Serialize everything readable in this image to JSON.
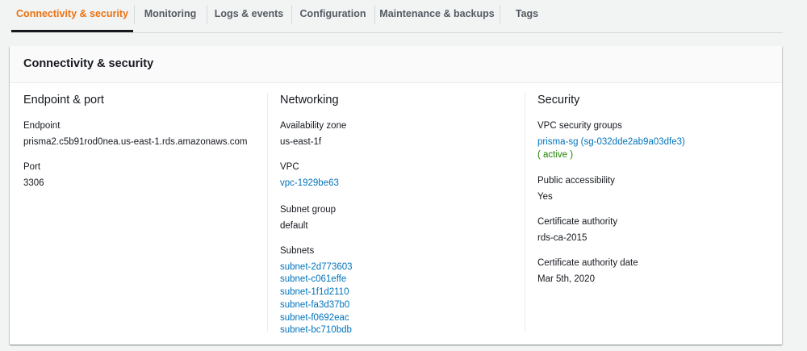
{
  "tabs": [
    {
      "label": "Connectivity & security",
      "active": true
    },
    {
      "label": "Monitoring",
      "active": false
    },
    {
      "label": "Logs & events",
      "active": false
    },
    {
      "label": "Configuration",
      "active": false
    },
    {
      "label": "Maintenance & backups",
      "active": false
    },
    {
      "label": "Tags",
      "active": false
    }
  ],
  "panel": {
    "title": "Connectivity & security"
  },
  "endpoint_port": {
    "title": "Endpoint & port",
    "endpoint_label": "Endpoint",
    "endpoint_value": "prisma2.c5b91rod0nea.us-east-1.rds.amazonaws.com",
    "port_label": "Port",
    "port_value": "3306"
  },
  "networking": {
    "title": "Networking",
    "az_label": "Availability zone",
    "az_value": "us-east-1f",
    "vpc_label": "VPC",
    "vpc_value": "vpc-1929be63",
    "subnet_group_label": "Subnet group",
    "subnet_group_value": "default",
    "subnets_label": "Subnets",
    "subnets": [
      "subnet-2d773603",
      "subnet-c061effe",
      "subnet-1f1d2110",
      "subnet-fa3d37b0",
      "subnet-f0692eac",
      "subnet-bc710bdb"
    ]
  },
  "security": {
    "title": "Security",
    "sg_label": "VPC security groups",
    "sg_value": "prisma-sg (sg-032dde2ab9a03dfe3)",
    "sg_status": "( active )",
    "public_label": "Public accessibility",
    "public_value": "Yes",
    "ca_label": "Certificate authority",
    "ca_value": "rds-ca-2015",
    "ca_date_label": "Certificate authority date",
    "ca_date_value": "Mar 5th, 2020"
  },
  "colors": {
    "active_tab": "#ec7211",
    "link": "#0073bb",
    "status_active": "#1d8102"
  }
}
